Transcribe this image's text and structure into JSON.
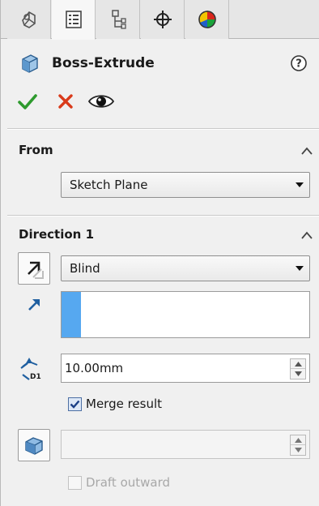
{
  "tabs": [
    {
      "name": "feature-manager",
      "icon": "feature-tree-icon",
      "active": false
    },
    {
      "name": "property-manager",
      "icon": "property-list-icon",
      "active": true
    },
    {
      "name": "configuration-manager",
      "icon": "configuration-icon",
      "active": false
    },
    {
      "name": "dimxpert-manager",
      "icon": "crosshair-icon",
      "active": false
    },
    {
      "name": "display-manager",
      "icon": "appearance-pie-icon",
      "active": false
    }
  ],
  "header": {
    "title": "Boss-Extrude",
    "icon": "boss-extrude-icon",
    "help_icon": "help-icon"
  },
  "actions": {
    "ok_icon": "checkmark-icon",
    "cancel_icon": "close-icon",
    "preview_icon": "eye-icon"
  },
  "from": {
    "title": "From",
    "selected": "Sketch Plane"
  },
  "direction1": {
    "title": "Direction 1",
    "end_condition": "Blind",
    "depth": "10.00mm",
    "merge_result_label": "Merge result",
    "merge_result_checked": true,
    "draft_value": "",
    "draft_outward_label": "Draft outward",
    "draft_outward_enabled": false
  },
  "colors": {
    "selection_bar": "#56a8f0",
    "ok_green": "#2e9a2e",
    "cancel_red": "#d93a1a"
  }
}
